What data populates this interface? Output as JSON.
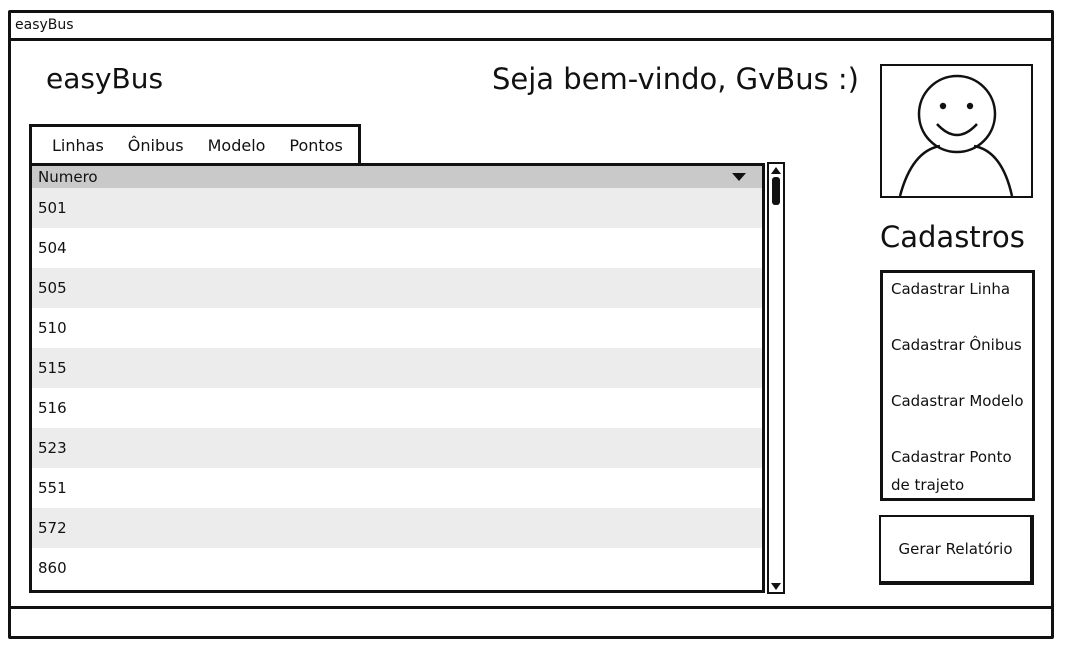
{
  "window": {
    "title": "easyBus"
  },
  "header": {
    "brand": "easyBus",
    "welcome": "Seja bem-vindo, GvBus :)"
  },
  "tabs": [
    {
      "label": "Linhas"
    },
    {
      "label": "Ônibus"
    },
    {
      "label": "Modelo"
    },
    {
      "label": "Pontos"
    }
  ],
  "table": {
    "column": "Numero",
    "rows": [
      "501",
      "504",
      "505",
      "510",
      "515",
      "516",
      "523",
      "551",
      "572",
      "860"
    ]
  },
  "sidebar": {
    "section_title": "Cadastros",
    "items": [
      {
        "label": "Cadastrar Linha"
      },
      {
        "label": "Cadastrar Ônibus"
      },
      {
        "label": "Cadastrar Modelo"
      },
      {
        "label": "Cadastrar Ponto de trajeto"
      }
    ],
    "report_button": "Gerar Relatório"
  },
  "icons": {
    "avatar": "user-avatar-icon",
    "sort": "caret-down-icon",
    "scroll_up": "arrow-up-icon",
    "scroll_down": "arrow-down-icon"
  },
  "colors": {
    "border": "#111111",
    "header_bg": "#c9c9c9",
    "row_alt": "#ececec"
  }
}
